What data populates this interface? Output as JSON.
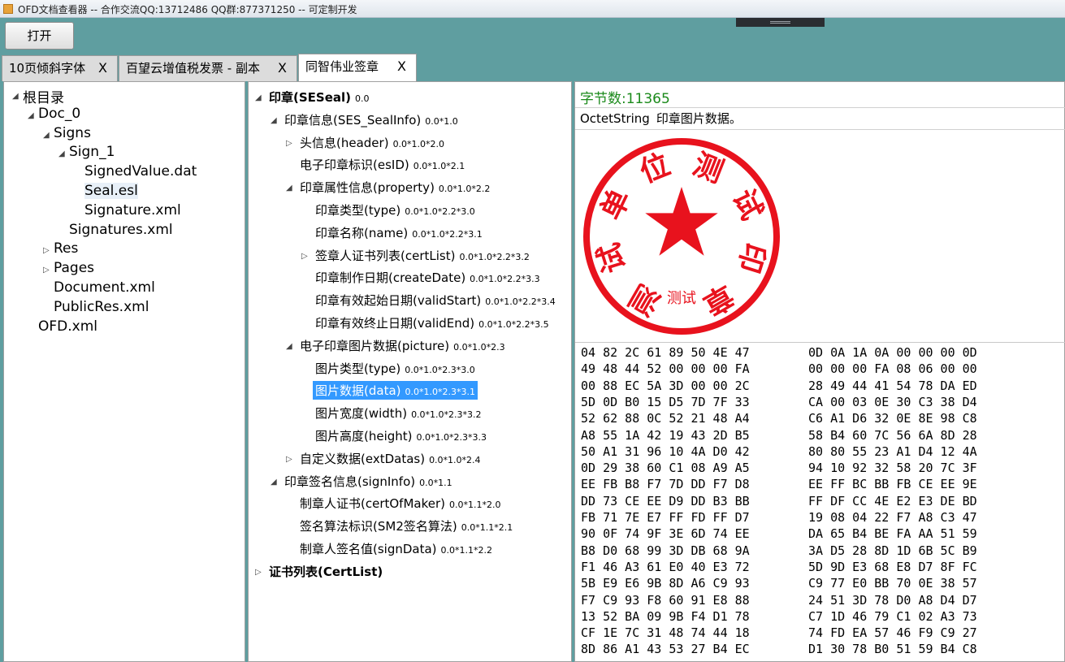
{
  "window": {
    "title": "OFD文档查看器 --  合作交流QQ:13712486 QQ群:877371250 -- 可定制开发"
  },
  "toolbar": {
    "open_label": "打开"
  },
  "tabs": [
    {
      "label": "10页倾斜字体",
      "close": "X"
    },
    {
      "label": "百望云增值税发票 - 副本",
      "close": "X"
    },
    {
      "label": "同智伟业签章",
      "close": "X"
    }
  ],
  "file_tree": [
    {
      "label": "根目录",
      "arrow": "◢"
    },
    {
      "label": "Doc_0",
      "arrow": "◢"
    },
    {
      "label": "Signs",
      "arrow": "◢"
    },
    {
      "label": "Sign_1",
      "arrow": "◢"
    },
    {
      "label": "SignedValue.dat",
      "arrow": ""
    },
    {
      "label": "Seal.esl",
      "arrow": ""
    },
    {
      "label": "Signature.xml",
      "arrow": ""
    },
    {
      "label": "Signatures.xml",
      "arrow": ""
    },
    {
      "label": "Res",
      "arrow": "▷"
    },
    {
      "label": "Pages",
      "arrow": "▷"
    },
    {
      "label": "Document.xml",
      "arrow": ""
    },
    {
      "label": "PublicRes.xml",
      "arrow": ""
    },
    {
      "label": "OFD.xml",
      "arrow": ""
    }
  ],
  "asn_tree": [
    {
      "label": "印章(SESeal)",
      "code": "0.0",
      "arrow": "◢"
    },
    {
      "label": "印章信息(SES_SealInfo)",
      "code": "0.0*1.0",
      "arrow": "◢"
    },
    {
      "label": "头信息(header)",
      "code": "0.0*1.0*2.0",
      "arrow": "▷"
    },
    {
      "label": "电子印章标识(esID)",
      "code": "0.0*1.0*2.1",
      "arrow": ""
    },
    {
      "label": "印章属性信息(property)",
      "code": "0.0*1.0*2.2",
      "arrow": "◢"
    },
    {
      "label": "印章类型(type)",
      "code": "0.0*1.0*2.2*3.0",
      "arrow": ""
    },
    {
      "label": "印章名称(name)",
      "code": "0.0*1.0*2.2*3.1",
      "arrow": ""
    },
    {
      "label": "签章人证书列表(certList)",
      "code": "0.0*1.0*2.2*3.2",
      "arrow": "▷"
    },
    {
      "label": "印章制作日期(createDate)",
      "code": "0.0*1.0*2.2*3.3",
      "arrow": ""
    },
    {
      "label": "印章有效起始日期(validStart)",
      "code": "0.0*1.0*2.2*3.4",
      "arrow": ""
    },
    {
      "label": "印章有效终止日期(validEnd)",
      "code": "0.0*1.0*2.2*3.5",
      "arrow": ""
    },
    {
      "label": "电子印章图片数据(picture)",
      "code": "0.0*1.0*2.3",
      "arrow": "◢"
    },
    {
      "label": "图片类型(type)",
      "code": "0.0*1.0*2.3*3.0",
      "arrow": ""
    },
    {
      "label": "图片数据(data)",
      "code": "0.0*1.0*2.3*3.1",
      "arrow": ""
    },
    {
      "label": "图片宽度(width)",
      "code": "0.0*1.0*2.3*3.2",
      "arrow": ""
    },
    {
      "label": "图片高度(height)",
      "code": "0.0*1.0*2.3*3.3",
      "arrow": ""
    },
    {
      "label": "自定义数据(extDatas)",
      "code": "0.0*1.0*2.4",
      "arrow": "▷"
    },
    {
      "label": "印章签名信息(signInfo)",
      "code": "0.0*1.1",
      "arrow": "◢"
    },
    {
      "label": "制章人证书(certOfMaker)",
      "code": "0.0*1.1*2.0",
      "arrow": ""
    },
    {
      "label": "签名算法标识(SM2签名算法)",
      "code": "0.0*1.1*2.1",
      "arrow": ""
    },
    {
      "label": "制章人签名值(signData)",
      "code": "0.0*1.1*2.2",
      "arrow": ""
    },
    {
      "label": "证书列表(CertList)",
      "code": "",
      "arrow": "▷"
    }
  ],
  "detail": {
    "byte_count": "字节数:11365",
    "type_name": "OctetString",
    "type_desc": "印章图片数据。",
    "seal": {
      "top_text": "测试单位测试印章",
      "bottom_text": "测试",
      "color": "#e8121d"
    },
    "hex_rows": [
      [
        "04 82 2C 61 89 50 4E 47",
        "0D 0A 1A 0A 00 00 00 0D"
      ],
      [
        "49 48 44 52 00 00 00 FA",
        "00 00 00 FA 08 06 00 00"
      ],
      [
        "00 88 EC 5A 3D 00 00 2C",
        "28 49 44 41 54 78 DA ED"
      ],
      [
        "5D 0D B0 15 D5 7D 7F 33",
        "CA 00 03 0E 30 C3 38 D4"
      ],
      [
        "52 62 88 0C 52 21 48 A4",
        "C6 A1 D6 32 0E 8E 98 C8"
      ],
      [
        "A8 55 1A 42 19 43 2D B5",
        "58 B4 60 7C 56 6A 8D 28"
      ],
      [
        "50 A1 31 96 10 4A D0 42",
        "80 80 55 23 A1 D4 12 4A"
      ],
      [
        "0D 29 38 60 C1 08 A9 A5",
        "94 10 92 32 58 20 7C 3F"
      ],
      [
        "EE FB B8 F7 7D DD F7 D8",
        "EE FF BC BB FB CE EE 9E"
      ],
      [
        "DD 73 CE EE D9 DD B3 BB",
        "FF DF CC 4E E2 E3 DE BD"
      ],
      [
        "FB 71 7E E7 FF FD FF D7",
        "19 08 04 22 F7 A8 C3 47"
      ],
      [
        "90 0F 74 9F 3E 6D 74 EE",
        "DA 65 B4 BE FA AA 51 59"
      ],
      [
        "B8 D0 68 99 3D DB 68 9A",
        "3A D5 28 8D 1D 6B 5C B9"
      ],
      [
        "F1 46 A3 61 E0 40 E3 72",
        "5D 9D E3 68 E8 D7 8F FC"
      ],
      [
        "5B E9 E6 9B 8D A6 C9 93",
        "C9 77 E0 BB 70 0E 38 57"
      ],
      [
        "F7 C9 93 F8 60 91 E8 88",
        "24 51 3D 78 D0 A8 D4 D7"
      ],
      [
        "13 52 BA 09 9B F4 D1 78",
        "C7 1D 46 79 C1 02 A3 73"
      ],
      [
        "CF 1E 7C 31 48 74 44 18",
        "74 FD EA 57 46 F9 C9 27"
      ],
      [
        "8D 86 A1 43 53 27 B4 EC",
        "D1 30 78 B0 51 59 B4 C8"
      ]
    ]
  }
}
